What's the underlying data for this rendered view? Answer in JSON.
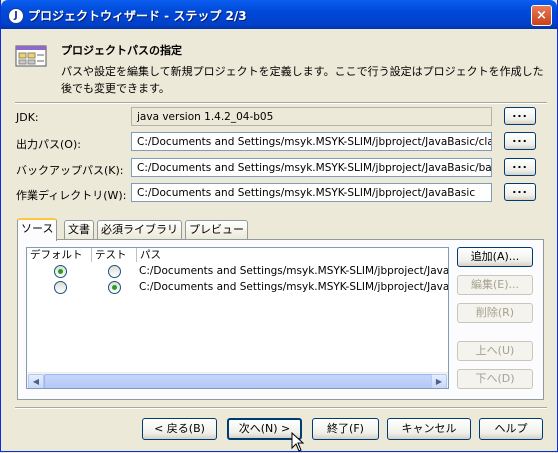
{
  "window": {
    "title": "プロジェクトウィザード - ステップ 2/3",
    "close_glyph": "×",
    "app_glyph": "J"
  },
  "header": {
    "title": "プロジェクトパスの指定",
    "description": "パスや設定を編集して新規プロジェクトを定義します。ここで行う設定はプロジェクトを作成した後でも変更できます。"
  },
  "form": {
    "jdk": {
      "label": "JDK:",
      "value": "java version 1.4.2_04-b05"
    },
    "output": {
      "label": "出力パス(O):",
      "value": "C:/Documents and Settings/msyk.MSYK-SLIM/jbproject/JavaBasic/classes"
    },
    "backup": {
      "label": "バックアップパス(K):",
      "value": "C:/Documents and Settings/msyk.MSYK-SLIM/jbproject/JavaBasic/bak"
    },
    "workdir": {
      "label": "作業ディレクトリ(W):",
      "value": "C:/Documents and Settings/msyk.MSYK-SLIM/jbproject/JavaBasic"
    },
    "browse_label": "..."
  },
  "tabs": [
    "ソース",
    "文書",
    "必須ライブラリ",
    "プレビュー"
  ],
  "source_table": {
    "columns": [
      "デフォルト",
      "テスト",
      "パス"
    ],
    "rows": [
      {
        "default": true,
        "test": false,
        "path": "C:/Documents and Settings/msyk.MSYK-SLIM/jbproject/JavaBasic/src"
      },
      {
        "default": false,
        "test": true,
        "path": "C:/Documents and Settings/msyk.MSYK-SLIM/jbproject/JavaBasic/test"
      }
    ]
  },
  "side_buttons": {
    "add": "追加(A)...",
    "edit": "編集(E)...",
    "remove": "削除(R)",
    "up": "上へ(U)",
    "down": "下へ(D)"
  },
  "footer": {
    "back": "< 戻る(B)",
    "next": "次へ(N) >",
    "finish": "終了(F)",
    "cancel": "キャンセル",
    "help": "ヘルプ"
  },
  "colors": {
    "titlebar": "#0049d8",
    "dialog_bg": "#ece9d8",
    "radio_dot": "#21a121",
    "tab_highlight": "#ffc83c"
  }
}
